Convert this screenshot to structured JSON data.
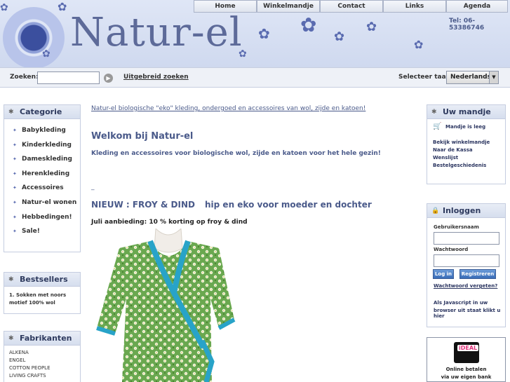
{
  "header": {
    "logo_text": "Natur-el",
    "phone": "Tel: 06-53386746",
    "nav": [
      "Home",
      "Winkelmandje",
      "Contact",
      "Links",
      "Agenda"
    ]
  },
  "searchbar": {
    "search_label": "Zoeken:",
    "search_value": "",
    "advanced_search": "Uitgebreid zoeken",
    "language_label": "Selecteer taal:",
    "language_selected": "Nederlands"
  },
  "categories": {
    "title": "Categorie",
    "items": [
      "Babykleding",
      "Kinderkleding",
      "Dameskleding",
      "Herenkleding",
      "Accessoires",
      "Natur-el wonen",
      "Hebbedingen!",
      "Sale!"
    ]
  },
  "bestsellers": {
    "title": "Bestsellers",
    "items": [
      "1. Sokken met noors",
      "motief 100% wol"
    ]
  },
  "manufacturers": {
    "title": "Fabrikanten",
    "items": [
      "ALKENA",
      "ENGEL",
      "COTTON PEOPLE",
      "LIVING CRAFTS"
    ]
  },
  "main": {
    "tagline": "Natur-el biologische \"eko\" kleding, ondergoed en accessoires van wol, zijde en katoen!",
    "welcome": "Welkom bij Natur-el",
    "subtitle": "Kleding en accessoires voor biologische wol, zijde en katoen voor het hele gezin!",
    "dash": "_",
    "new_left": "NIEUW : FROY & DIND",
    "new_right": "hip en eko voor moeder en dochter",
    "offer": "Juli aanbieding: 10 % korting op froy & dind"
  },
  "cart": {
    "title": "Uw mandje",
    "empty": "Mandje is leeg",
    "links": [
      "Bekijk winkelmandje",
      "Naar de Kassa",
      "Wenslijst",
      "Bestelgeschiedenis"
    ]
  },
  "login": {
    "title": "Inloggen",
    "username_label": "Gebruikersnaam",
    "password_label": "Wachtwoord",
    "login_button": "Log in",
    "register_button": "Registreren",
    "forgot": "Wachtwoord vergeten?",
    "js_note_1": "Als Javascript in uw",
    "js_note_2": "browser uit staat klikt u hier"
  },
  "ideal": {
    "logo_text": "iDEAL",
    "line1": "Online betalen",
    "line2": "via uw eigen bank"
  },
  "colors": {
    "accent": "#4a5a8a",
    "header_bg": "#dfe6f6",
    "box_border": "#c5cde0"
  }
}
